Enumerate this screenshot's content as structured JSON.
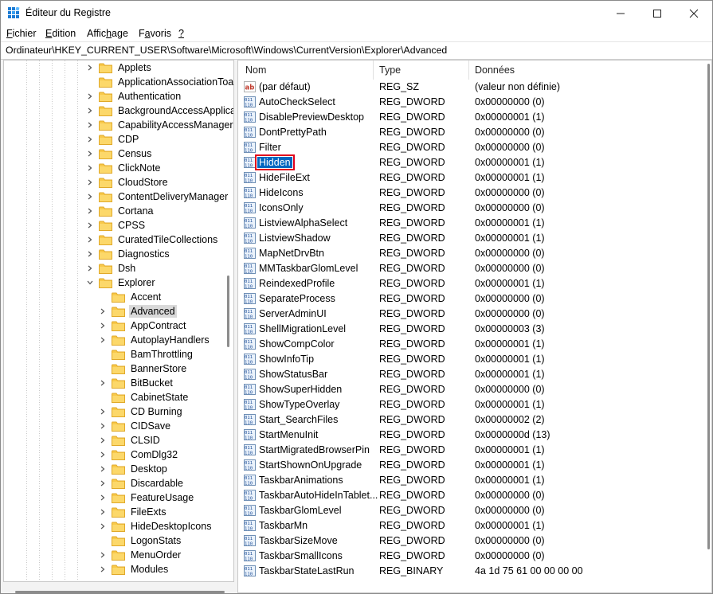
{
  "window": {
    "title": "Éditeur du Registre",
    "minimize": "—",
    "maximize": "☐",
    "close": "✕"
  },
  "menu": [
    {
      "pre": "",
      "u": "F",
      "post": "ichier"
    },
    {
      "pre": "",
      "u": "E",
      "post": "dition"
    },
    {
      "pre": "Affic",
      "u": "h",
      "post": "age"
    },
    {
      "pre": "F",
      "u": "a",
      "post": "voris"
    },
    {
      "pre": "",
      "u": "?",
      "post": ""
    }
  ],
  "address": "Ordinateur\\HKEY_CURRENT_USER\\Software\\Microsoft\\Windows\\CurrentVersion\\Explorer\\Advanced",
  "colors": {
    "folder": "#f8c94a",
    "folder_dark": "#e0a92a",
    "selection": "#0067c0",
    "highlight": "#e0001b"
  },
  "tree": [
    {
      "label": "Applets",
      "level": 0,
      "expander": "right"
    },
    {
      "label": "ApplicationAssociationToa",
      "level": 0,
      "expander": "none"
    },
    {
      "label": "Authentication",
      "level": 0,
      "expander": "right"
    },
    {
      "label": "BackgroundAccessApplica",
      "level": 0,
      "expander": "right"
    },
    {
      "label": "CapabilityAccessManager",
      "level": 0,
      "expander": "right"
    },
    {
      "label": "CDP",
      "level": 0,
      "expander": "right"
    },
    {
      "label": "Census",
      "level": 0,
      "expander": "right"
    },
    {
      "label": "ClickNote",
      "level": 0,
      "expander": "right"
    },
    {
      "label": "CloudStore",
      "level": 0,
      "expander": "right"
    },
    {
      "label": "ContentDeliveryManager",
      "level": 0,
      "expander": "right"
    },
    {
      "label": "Cortana",
      "level": 0,
      "expander": "right"
    },
    {
      "label": "CPSS",
      "level": 0,
      "expander": "right"
    },
    {
      "label": "CuratedTileCollections",
      "level": 0,
      "expander": "right"
    },
    {
      "label": "Diagnostics",
      "level": 0,
      "expander": "right"
    },
    {
      "label": "Dsh",
      "level": 0,
      "expander": "right"
    },
    {
      "label": "Explorer",
      "level": 0,
      "expander": "down"
    },
    {
      "label": "Accent",
      "level": 1,
      "expander": "none"
    },
    {
      "label": "Advanced",
      "level": 1,
      "expander": "right",
      "selected": true
    },
    {
      "label": "AppContract",
      "level": 1,
      "expander": "right"
    },
    {
      "label": "AutoplayHandlers",
      "level": 1,
      "expander": "right"
    },
    {
      "label": "BamThrottling",
      "level": 1,
      "expander": "none"
    },
    {
      "label": "BannerStore",
      "level": 1,
      "expander": "none"
    },
    {
      "label": "BitBucket",
      "level": 1,
      "expander": "right"
    },
    {
      "label": "CabinetState",
      "level": 1,
      "expander": "none"
    },
    {
      "label": "CD Burning",
      "level": 1,
      "expander": "right"
    },
    {
      "label": "CIDSave",
      "level": 1,
      "expander": "right"
    },
    {
      "label": "CLSID",
      "level": 1,
      "expander": "right"
    },
    {
      "label": "ComDlg32",
      "level": 1,
      "expander": "right"
    },
    {
      "label": "Desktop",
      "level": 1,
      "expander": "right"
    },
    {
      "label": "Discardable",
      "level": 1,
      "expander": "right"
    },
    {
      "label": "FeatureUsage",
      "level": 1,
      "expander": "right"
    },
    {
      "label": "FileExts",
      "level": 1,
      "expander": "right"
    },
    {
      "label": "HideDesktopIcons",
      "level": 1,
      "expander": "right"
    },
    {
      "label": "LogonStats",
      "level": 1,
      "expander": "none"
    },
    {
      "label": "MenuOrder",
      "level": 1,
      "expander": "right"
    },
    {
      "label": "Modules",
      "level": 1,
      "expander": "right"
    }
  ],
  "columns": {
    "name": "Nom",
    "type": "Type",
    "data": "Données"
  },
  "values": [
    {
      "name": "(par défaut)",
      "type": "REG_SZ",
      "data": "(valeur non définie)",
      "icon": "string-value-icon"
    },
    {
      "name": "AutoCheckSelect",
      "type": "REG_DWORD",
      "data": "0x00000000 (0)",
      "icon": "binary-value-icon"
    },
    {
      "name": "DisablePreviewDesktop",
      "type": "REG_DWORD",
      "data": "0x00000001 (1)",
      "icon": "binary-value-icon"
    },
    {
      "name": "DontPrettyPath",
      "type": "REG_DWORD",
      "data": "0x00000000 (0)",
      "icon": "binary-value-icon"
    },
    {
      "name": "Filter",
      "type": "REG_DWORD",
      "data": "0x00000000 (0)",
      "icon": "binary-value-icon"
    },
    {
      "name": "Hidden",
      "type": "REG_DWORD",
      "data": "0x00000001 (1)",
      "icon": "binary-value-icon",
      "selected": true
    },
    {
      "name": "HideFileExt",
      "type": "REG_DWORD",
      "data": "0x00000001 (1)",
      "icon": "binary-value-icon"
    },
    {
      "name": "HideIcons",
      "type": "REG_DWORD",
      "data": "0x00000000 (0)",
      "icon": "binary-value-icon"
    },
    {
      "name": "IconsOnly",
      "type": "REG_DWORD",
      "data": "0x00000000 (0)",
      "icon": "binary-value-icon"
    },
    {
      "name": "ListviewAlphaSelect",
      "type": "REG_DWORD",
      "data": "0x00000001 (1)",
      "icon": "binary-value-icon"
    },
    {
      "name": "ListviewShadow",
      "type": "REG_DWORD",
      "data": "0x00000001 (1)",
      "icon": "binary-value-icon"
    },
    {
      "name": "MapNetDrvBtn",
      "type": "REG_DWORD",
      "data": "0x00000000 (0)",
      "icon": "binary-value-icon"
    },
    {
      "name": "MMTaskbarGlomLevel",
      "type": "REG_DWORD",
      "data": "0x00000000 (0)",
      "icon": "binary-value-icon"
    },
    {
      "name": "ReindexedProfile",
      "type": "REG_DWORD",
      "data": "0x00000001 (1)",
      "icon": "binary-value-icon"
    },
    {
      "name": "SeparateProcess",
      "type": "REG_DWORD",
      "data": "0x00000000 (0)",
      "icon": "binary-value-icon"
    },
    {
      "name": "ServerAdminUI",
      "type": "REG_DWORD",
      "data": "0x00000000 (0)",
      "icon": "binary-value-icon"
    },
    {
      "name": "ShellMigrationLevel",
      "type": "REG_DWORD",
      "data": "0x00000003 (3)",
      "icon": "binary-value-icon"
    },
    {
      "name": "ShowCompColor",
      "type": "REG_DWORD",
      "data": "0x00000001 (1)",
      "icon": "binary-value-icon"
    },
    {
      "name": "ShowInfoTip",
      "type": "REG_DWORD",
      "data": "0x00000001 (1)",
      "icon": "binary-value-icon"
    },
    {
      "name": "ShowStatusBar",
      "type": "REG_DWORD",
      "data": "0x00000001 (1)",
      "icon": "binary-value-icon"
    },
    {
      "name": "ShowSuperHidden",
      "type": "REG_DWORD",
      "data": "0x00000000 (0)",
      "icon": "binary-value-icon"
    },
    {
      "name": "ShowTypeOverlay",
      "type": "REG_DWORD",
      "data": "0x00000001 (1)",
      "icon": "binary-value-icon"
    },
    {
      "name": "Start_SearchFiles",
      "type": "REG_DWORD",
      "data": "0x00000002 (2)",
      "icon": "binary-value-icon"
    },
    {
      "name": "StartMenuInit",
      "type": "REG_DWORD",
      "data": "0x0000000d (13)",
      "icon": "binary-value-icon"
    },
    {
      "name": "StartMigratedBrowserPin",
      "type": "REG_DWORD",
      "data": "0x00000001 (1)",
      "icon": "binary-value-icon"
    },
    {
      "name": "StartShownOnUpgrade",
      "type": "REG_DWORD",
      "data": "0x00000001 (1)",
      "icon": "binary-value-icon"
    },
    {
      "name": "TaskbarAnimations",
      "type": "REG_DWORD",
      "data": "0x00000001 (1)",
      "icon": "binary-value-icon"
    },
    {
      "name": "TaskbarAutoHideInTablet...",
      "type": "REG_DWORD",
      "data": "0x00000000 (0)",
      "icon": "binary-value-icon"
    },
    {
      "name": "TaskbarGlomLevel",
      "type": "REG_DWORD",
      "data": "0x00000000 (0)",
      "icon": "binary-value-icon"
    },
    {
      "name": "TaskbarMn",
      "type": "REG_DWORD",
      "data": "0x00000001 (1)",
      "icon": "binary-value-icon"
    },
    {
      "name": "TaskbarSizeMove",
      "type": "REG_DWORD",
      "data": "0x00000000 (0)",
      "icon": "binary-value-icon"
    },
    {
      "name": "TaskbarSmallIcons",
      "type": "REG_DWORD",
      "data": "0x00000000 (0)",
      "icon": "binary-value-icon"
    },
    {
      "name": "TaskbarStateLastRun",
      "type": "REG_BINARY",
      "data": "4a 1d 75 61 00 00 00 00",
      "icon": "binary-value-icon"
    }
  ]
}
